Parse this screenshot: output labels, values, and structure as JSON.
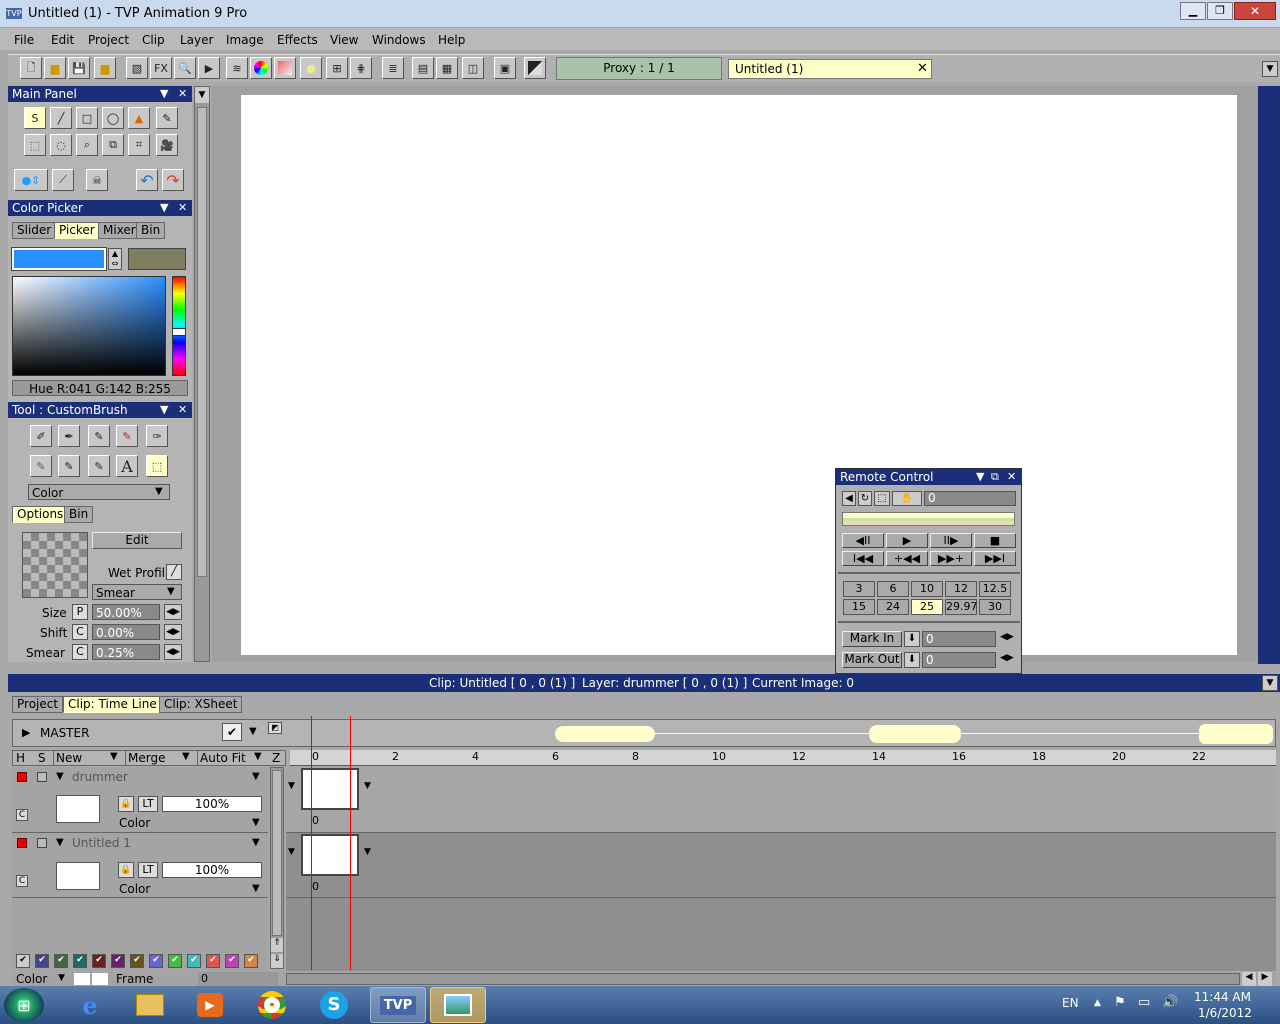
{
  "window": {
    "title": "Untitled (1) - TVP Animation 9 Pro"
  },
  "menu": [
    "File",
    "Edit",
    "Project",
    "Clip",
    "Layer",
    "Image",
    "Effects",
    "View",
    "Windows",
    "Help"
  ],
  "toolbar": {
    "proxy": "Proxy : 1 / 1",
    "doc_tab": "Untitled (1)",
    "fx": "FX"
  },
  "main_panel": {
    "title": "Main Panel"
  },
  "color_picker": {
    "title": "Color Picker",
    "tabs": [
      "Slider",
      "Picker",
      "Mixer",
      "Bin"
    ],
    "active_tab": "Picker",
    "readout": "Hue R:041 G:142 B:255",
    "primary_color": "#298eff",
    "secondary_color": "#7f7f5f"
  },
  "tool_panel": {
    "title": "Tool : CustomBrush",
    "mode": "Color",
    "tabs": [
      "Options",
      "Bin"
    ],
    "edit": "Edit",
    "wet_profil": "Wet Profil",
    "smear_mode": "Smear",
    "size_label": "Size",
    "size_flag": "P",
    "size_value": "50.00%",
    "shift_label": "Shift",
    "shift_flag": "C",
    "shift_value": "0.00%",
    "smear_label": "Smear",
    "smear_flag": "C",
    "smear_value": "0.25%",
    "text_tool": "A"
  },
  "remote": {
    "title": "Remote Control",
    "frame": "0",
    "fps": [
      "3",
      "6",
      "10",
      "12",
      "12.5",
      "15",
      "24",
      "25",
      "29.97",
      "30"
    ],
    "selected_fps": "25",
    "mark_in": "Mark In",
    "mark_in_value": "0",
    "mark_out": "Mark Out",
    "mark_out_value": "0"
  },
  "status": {
    "clip": "Clip: Untitled [ 0 , 0  (1) ]",
    "layer": "Layer: drummer [ 0 , 0  (1) ]",
    "image": "Current Image: 0"
  },
  "timeline": {
    "tabs": [
      "Project",
      "Clip: Time Line",
      "Clip: XSheet"
    ],
    "active_tab": "Clip: Time Line",
    "master": "MASTER",
    "cols": {
      "h": "H",
      "s": "S",
      "new": "New",
      "merge": "Merge",
      "autofit": "Auto Fit",
      "z": "Z"
    },
    "ruler": [
      "0",
      "2",
      "4",
      "6",
      "8",
      "10",
      "12",
      "14",
      "16",
      "18",
      "20",
      "22"
    ],
    "layers": [
      {
        "name": "drummer",
        "opacity": "100%",
        "mode": "Color",
        "frame": "0",
        "lt": "LT",
        "c": "C"
      },
      {
        "name": "Untitled 1",
        "opacity": "100%",
        "mode": "Color",
        "frame": "0",
        "lt": "LT",
        "c": "C"
      }
    ],
    "bottom": {
      "color": "Color",
      "frame": "Frame",
      "frame_value": "0"
    }
  },
  "taskbar": {
    "lang": "EN",
    "time": "11:44 AM",
    "date": "1/6/2012",
    "tvp": "TVP"
  }
}
